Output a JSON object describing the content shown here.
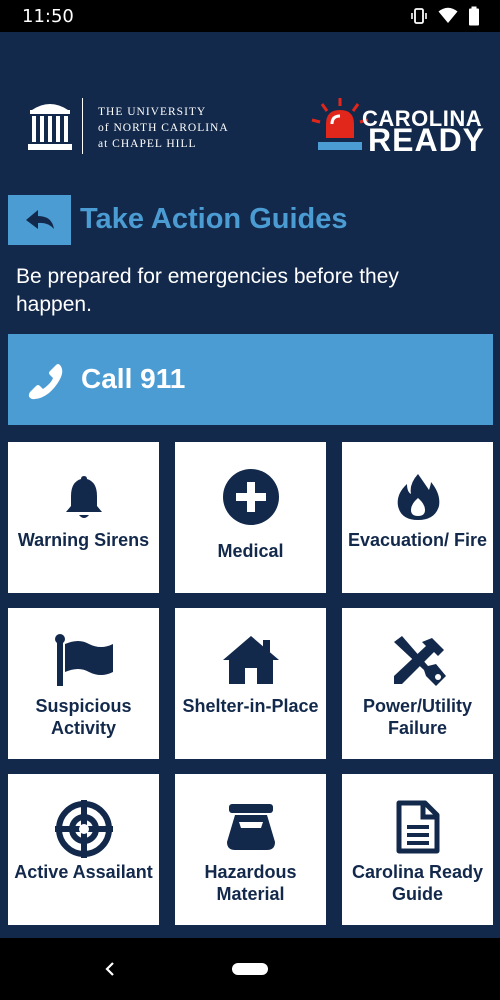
{
  "status": {
    "time": "11:50"
  },
  "header": {
    "unc_lines": [
      "THE UNIVERSITY",
      "of NORTH CAROLINA",
      "at CHAPEL HILL"
    ],
    "cr_line1": "CAROLINA",
    "cr_line2": "READY"
  },
  "page": {
    "title": "Take Action Guides",
    "subtitle": "Be prepared for emergencies before they happen."
  },
  "call": {
    "label": "Call 911"
  },
  "tiles": [
    {
      "label": "Warning Sirens",
      "icon": "bell-icon"
    },
    {
      "label": "Medical",
      "icon": "medical-cross-icon"
    },
    {
      "label": "Evacuation/ Fire",
      "icon": "fire-icon"
    },
    {
      "label": "Suspicious Activity",
      "icon": "flag-icon"
    },
    {
      "label": "Shelter-in-Place",
      "icon": "house-icon"
    },
    {
      "label": "Power/Utility Failure",
      "icon": "tools-icon"
    },
    {
      "label": "Active Assailant",
      "icon": "crosshair-icon"
    },
    {
      "label": "Hazardous Material",
      "icon": "hazmat-container-icon"
    },
    {
      "label": "Carolina Ready Guide",
      "icon": "document-icon"
    }
  ],
  "colors": {
    "navy": "#13294b",
    "carolina_blue": "#4b9cd3",
    "siren_red": "#e1261c"
  }
}
